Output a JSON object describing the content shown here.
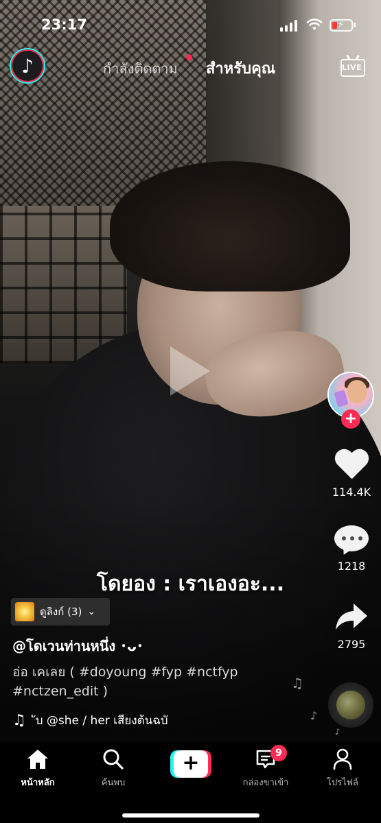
{
  "status_bar": {
    "time": "23:17"
  },
  "header": {
    "logo_icon": "tiktok-logo-icon",
    "tab_following": "กำลังติดตาม",
    "tab_for_you": "สำหรับคุณ",
    "live_label": "LIVE"
  },
  "video": {
    "overlay_text": "โดยอง : เราเองอะ...",
    "effect_label": "ดูลิงก์ (3)",
    "username": "@โดเวนท่านหนึ่ง ･ᴗ･",
    "description": "อ่อ เคเลย ( #doyoung #fyp #nctfyp #nctzen_edit )",
    "sound": "ับ    @she / her เสียงต้นฉบั"
  },
  "rail": {
    "likes": "114.4K",
    "comments": "1218",
    "shares": "2795"
  },
  "bottom_nav": {
    "home": "หน้าหลัก",
    "discover": "ค้นพบ",
    "inbox": "กล่องขาเข้า",
    "inbox_badge": "9",
    "profile": "โปรไฟล์"
  },
  "colors": {
    "accent_red": "#fe2c55",
    "accent_cyan": "#25f4ee"
  }
}
